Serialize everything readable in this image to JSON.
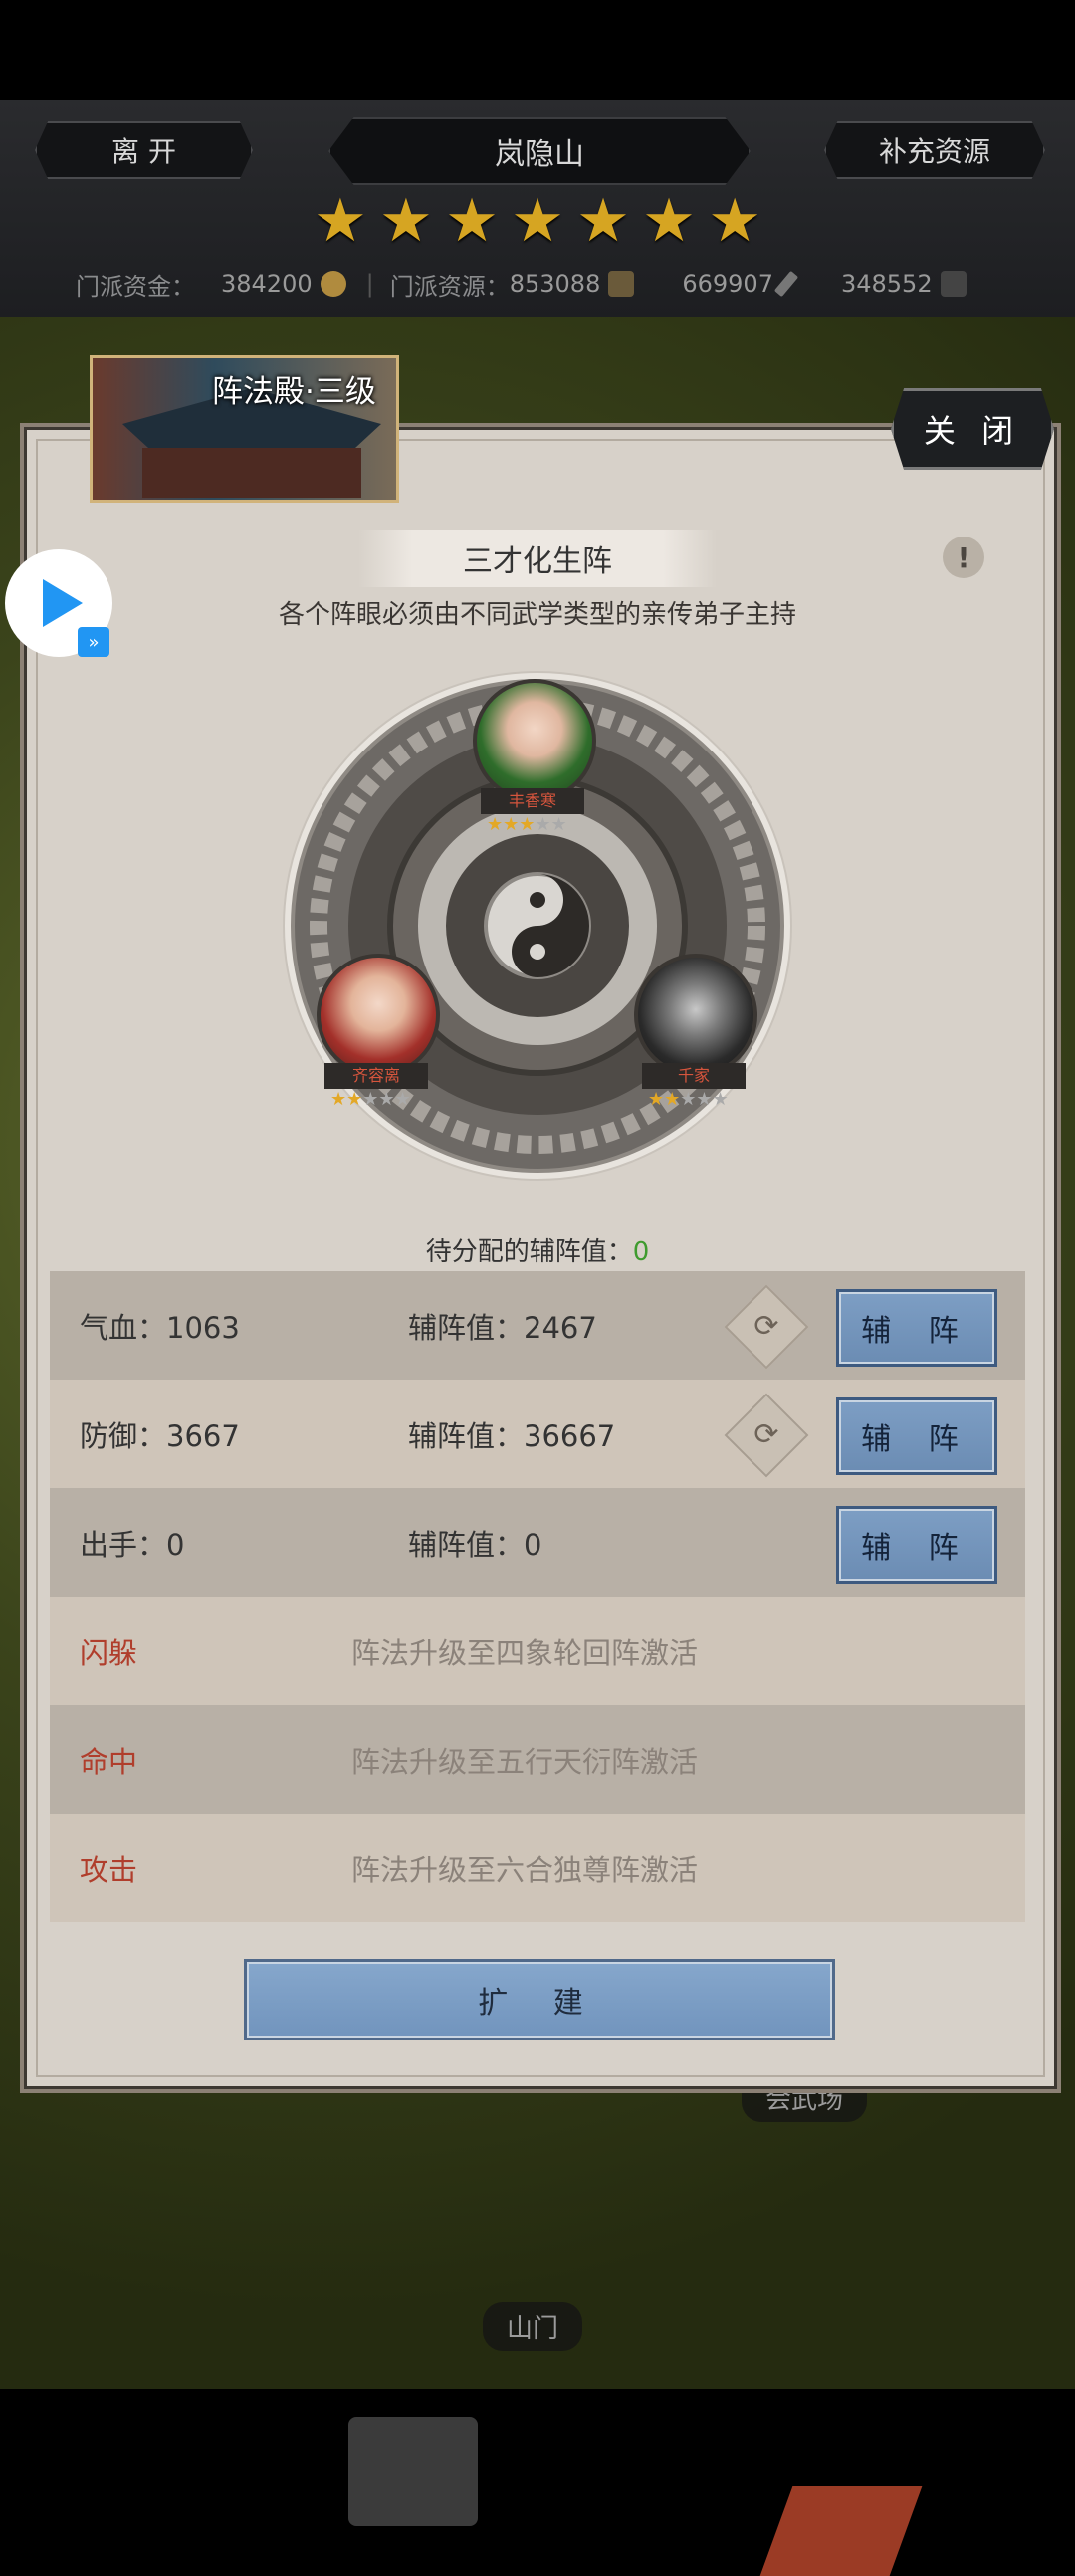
{
  "header": {
    "leave_label": "离 开",
    "location": "岚隐山",
    "supply_label": "补充资源",
    "star_count": 7,
    "funds_label": "门派资金：",
    "funds_value": "384200",
    "resources_label": "门派资源：",
    "resources_value": "853088",
    "res2_value": "669907",
    "res3_value": "348552"
  },
  "panel": {
    "hall_title": "阵法殿·三级",
    "close_label": "关 闭",
    "formation_name": "三才化生阵",
    "info_symbol": "!",
    "subtitle": "各个阵眼必须由不同武学类型的亲传弟子主持",
    "disciples": [
      {
        "name": "丰香寒",
        "stars": 3
      },
      {
        "name": "齐容离",
        "stars": 2
      },
      {
        "name": "千家",
        "stars": 2
      }
    ],
    "pending_label": "待分配的辅阵值：",
    "pending_value": "0",
    "stats": [
      {
        "label": "气血：1063",
        "assist": "辅阵值：2467",
        "button": "辅 阵",
        "swap": true
      },
      {
        "label": "防御：3667",
        "assist": "辅阵值：36667",
        "button": "辅 阵",
        "swap": true
      },
      {
        "label": "出手：0",
        "assist": "辅阵值：0",
        "button": "辅 阵",
        "swap": false
      }
    ],
    "locked": [
      {
        "label": "闪躲",
        "hint": "阵法升级至四象轮回阵激活"
      },
      {
        "label": "命中",
        "hint": "阵法升级至五行天衍阵激活"
      },
      {
        "label": "攻击",
        "hint": "阵法升级至六合独尊阵激活"
      }
    ],
    "expand_label": "扩 建"
  },
  "map": {
    "label_arena": "会武场",
    "label_gate": "山门"
  },
  "colors": {
    "star": "#d6a522",
    "button_blue": "#7d9ec4",
    "locked_red": "#b03e2c",
    "pending_green": "#3f9b2f"
  }
}
